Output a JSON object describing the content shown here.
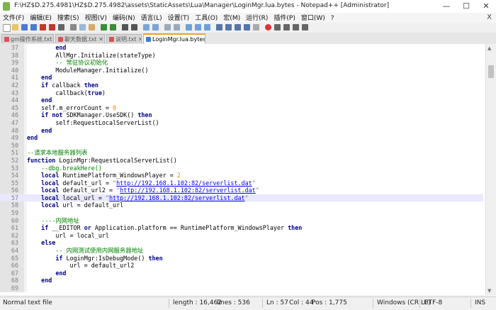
{
  "window": {
    "title": "F:\\HZ$D.275.4981\\HZ$D.275.4982\\assets\\StaticAssets\\Lua\\Manager\\LoginMgr.lua.bytes - Notepad++ [Administrator]",
    "minimize_glyph": "—",
    "maximize_glyph": "☐",
    "close_glyph": "✕"
  },
  "menu": {
    "items": [
      "文件(F)",
      "编辑(E)",
      "搜索(S)",
      "视图(V)",
      "编码(N)",
      "语言(L)",
      "设置(T)",
      "工具(O)",
      "宏(M)",
      "运行(R)",
      "插件(P)",
      "窗口(W)",
      "?"
    ],
    "close_glyph": "X"
  },
  "tabs": [
    {
      "label": "gm操作系统.txt",
      "close": "✕"
    },
    {
      "label": "聊天数据.txt",
      "close": "✕"
    },
    {
      "label": "说明.txt",
      "close": "✕"
    },
    {
      "label": "LoginMgr.lua.bytes",
      "close": "✕"
    }
  ],
  "code_lines": [
    {
      "num": "37",
      "text": "        end"
    },
    {
      "num": "38",
      "text": "        AllMgr.Initialize(stateType)"
    },
    {
      "num": "39",
      "text": "        -- 常驻协议初始化"
    },
    {
      "num": "40",
      "text": "        ModuleManager.Initialize()"
    },
    {
      "num": "41",
      "text": "    end"
    },
    {
      "num": "42",
      "text": "    if callback then"
    },
    {
      "num": "43",
      "text": "        callback(true)"
    },
    {
      "num": "44",
      "text": "    end"
    },
    {
      "num": "45",
      "text": "    self.m_errorCount = 0"
    },
    {
      "num": "46",
      "text": "    if not SDKManager.UseSDK() then"
    },
    {
      "num": "47",
      "text": "        self:RequestLocalServerList()"
    },
    {
      "num": "48",
      "text": "    end"
    },
    {
      "num": "49",
      "text": "end"
    },
    {
      "num": "50",
      "text": ""
    },
    {
      "num": "51",
      "text": "--请求本地服务器列表"
    },
    {
      "num": "52",
      "text": "function LoginMgr:RequestLocalServerList()"
    },
    {
      "num": "53",
      "text": "    --dbg.breakHere()"
    },
    {
      "num": "54",
      "text": "    local RuntimePlatform_WindowsPlayer = 2"
    },
    {
      "num": "55",
      "text": "    local default_url = \"http://192.168.1.102:82/serverlist.dat\""
    },
    {
      "num": "56",
      "text": "    local default_url2 = \"http://192.168.1.102:82/serverlist.dat\""
    },
    {
      "num": "57",
      "text": "    local local_url = \"http://192.168.1.102:82/serverlist.dat\""
    },
    {
      "num": "58",
      "text": "    local url = default_url"
    },
    {
      "num": "59",
      "text": ""
    },
    {
      "num": "60",
      "text": "    ----内网地址"
    },
    {
      "num": "61",
      "text": "    if __EDITOR or Application.platform == RuntimePlatform_WindowsPlayer then"
    },
    {
      "num": "62",
      "text": "        url = local_url"
    },
    {
      "num": "63",
      "text": "    else"
    },
    {
      "num": "64",
      "text": "        -- 内网测试使用内网服务器地址"
    },
    {
      "num": "65",
      "text": "        if LoginMgr:IsDebugMode() then"
    },
    {
      "num": "66",
      "text": "            url = default_url2"
    },
    {
      "num": "67",
      "text": "        end"
    },
    {
      "num": "68",
      "text": "    end"
    },
    {
      "num": "69",
      "text": ""
    }
  ],
  "current_line": "57",
  "status": {
    "file_type": "Normal text file",
    "length": "length : 16,462",
    "lines": "lines : 536",
    "ln": "Ln : 57",
    "col": "Col : 44",
    "pos": "Pos : 1,775",
    "eol": "Windows (CR LF)",
    "encoding": "UTF-8",
    "mode": "INS"
  },
  "colors": {
    "keyword": "#00008b",
    "comment": "#008000",
    "string": "#808080",
    "url": "#0000ff",
    "number": "#ff8000",
    "current_line_bg": "#e8e8ff"
  }
}
